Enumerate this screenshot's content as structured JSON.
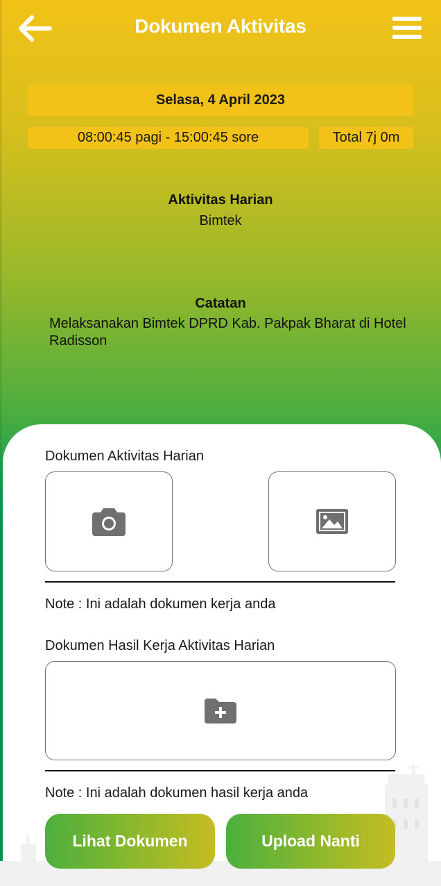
{
  "header": {
    "title": "Dokumen Aktivitas",
    "back_icon": "arrow-left-icon",
    "menu_icon": "hamburger-menu-icon"
  },
  "schedule": {
    "date": "Selasa, 4 April 2023",
    "time_range": "08:00:45 pagi - 15:00:45 sore",
    "total": "Total 7j 0m"
  },
  "activity": {
    "label": "Aktivitas Harian",
    "value": "Bimtek"
  },
  "notes": {
    "label": "Catatan",
    "value": "Melaksanakan Bimtek DPRD Kab. Pakpak Bharat di Hotel Radisson"
  },
  "documents": {
    "activity_title": "Dokumen Aktivitas Harian",
    "camera_icon": "camera-icon",
    "gallery_icon": "image-icon",
    "activity_note": "Note : Ini adalah dokumen kerja anda",
    "result_title": "Dokumen Hasil Kerja Aktivitas Harian",
    "folder_icon": "folder-add-icon",
    "result_note": "Note : Ini adalah dokumen hasil kerja anda"
  },
  "actions": {
    "view_label": "Lihat Dokumen",
    "later_label": "Upload Nanti"
  },
  "colors": {
    "accent_yellow": "#f2c218",
    "accent_green": "#0a9c56",
    "icon_gray": "#707070"
  }
}
